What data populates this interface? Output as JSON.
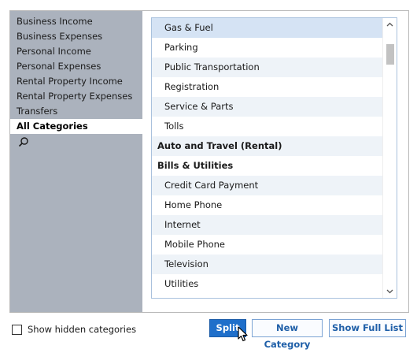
{
  "sidebar": {
    "items": [
      {
        "label": "Business Income"
      },
      {
        "label": "Business Expenses"
      },
      {
        "label": "Personal Income"
      },
      {
        "label": "Personal Expenses"
      },
      {
        "label": "Rental Property Income"
      },
      {
        "label": "Rental Property Expenses"
      },
      {
        "label": "Transfers"
      },
      {
        "label": "All Categories"
      }
    ],
    "selected_index": 7,
    "search_icon": "search-icon"
  },
  "list": {
    "rows": [
      {
        "label": "Gas & Fuel"
      },
      {
        "label": "Parking"
      },
      {
        "label": "Public Transportation"
      },
      {
        "label": "Registration"
      },
      {
        "label": "Service & Parts"
      },
      {
        "label": "Tolls"
      },
      {
        "label": "Auto and Travel (Rental)"
      },
      {
        "label": "Bills & Utilities"
      },
      {
        "label": "Credit Card Payment"
      },
      {
        "label": "Home Phone"
      },
      {
        "label": "Internet"
      },
      {
        "label": "Mobile Phone"
      },
      {
        "label": "Television"
      },
      {
        "label": "Utilities"
      }
    ],
    "selected_label": "Gas & Fuel"
  },
  "footer": {
    "show_hidden_label": "Show hidden categories",
    "show_hidden_checked": false,
    "split_label": "Split",
    "new_category_label": "New Category",
    "show_full_list_label": "Show Full List"
  },
  "colors": {
    "accent": "#1f6fca",
    "sidebar_bg": "#abb2bd",
    "row_alt": "#eef3f8",
    "row_selected": "#d5e3f4"
  }
}
